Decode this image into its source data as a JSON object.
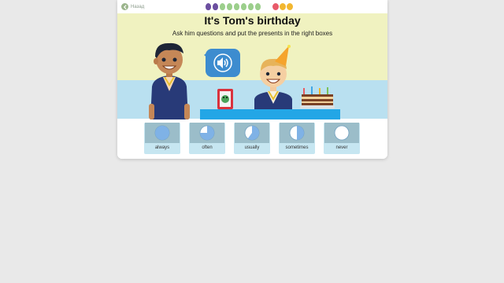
{
  "nav": {
    "back_label": "Назад"
  },
  "progress": {
    "dots": [
      "#6c4fa0",
      "#6c4fa0",
      "#9ccf8c",
      "#9ccf8c",
      "#9ccf8c",
      "#9ccf8c",
      "#9ccf8c",
      "#9ccf8c"
    ],
    "fruits": [
      "#e85a6a",
      "#f2b730",
      "#f2b730"
    ]
  },
  "activity": {
    "title": "It's Tom's birthday",
    "subtitle": "Ask him questions and put the presents in the right boxes"
  },
  "audio_button": {
    "icon": "speaker-icon"
  },
  "boxes": [
    {
      "label": "always",
      "fill": 1.0
    },
    {
      "label": "often",
      "fill": 0.75
    },
    {
      "label": "usually",
      "fill": 0.6
    },
    {
      "label": "sometimes",
      "fill": 0.5
    },
    {
      "label": "never",
      "fill": 0.0
    }
  ],
  "colors": {
    "wall": "#b9e0f0",
    "table": "#23a6e6",
    "bubble": "#3d8ccf",
    "scene": "#f0f2c0"
  }
}
